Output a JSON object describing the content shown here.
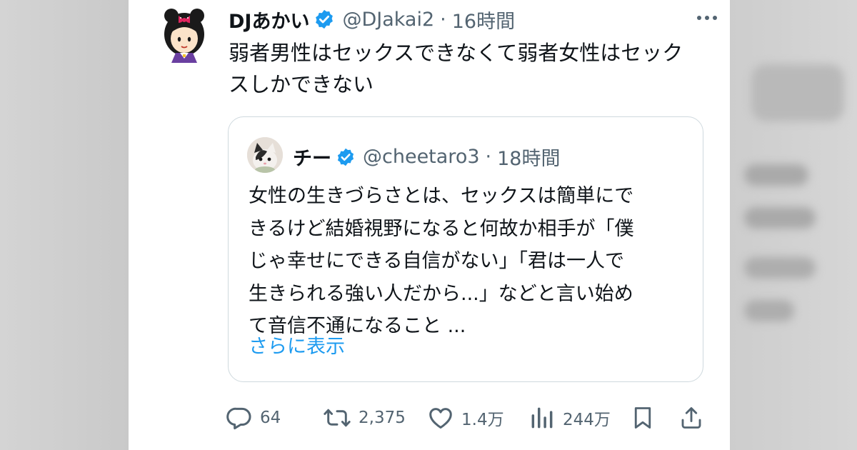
{
  "tweet": {
    "author_name": "DJあかい",
    "handle": "@DJakai2",
    "separator": "·",
    "time": "16時間",
    "text_line1": "弱者男性はセックスできなくて弱者女性はセック",
    "text_line2": "スしかできない"
  },
  "quote": {
    "author_name": "チー",
    "handle": "@cheetaro3",
    "separator": "·",
    "time": "18時間",
    "text_lines": [
      "女性の生きづらさとは、セックスは簡単にで",
      "きるけど結婚視野になると何故か相手が「僕",
      "じゃ幸せにできる自信がない」「君は一人で",
      "生きられる強い人だから...」などと言い始め",
      "て音信不通になること ..."
    ],
    "show_more": "さらに表示"
  },
  "actions": {
    "replies": "64",
    "retweets": "2,375",
    "likes": "1.4万",
    "views": "244万"
  },
  "icons": {
    "verified": "verified-badge-icon",
    "more": "more-dots-icon",
    "reply": "reply-bubble-icon",
    "retweet": "retweet-arrows-icon",
    "like": "heart-icon",
    "views": "bar-chart-icon",
    "bookmark": "bookmark-icon",
    "share": "share-upload-icon"
  },
  "colors": {
    "verified_blue": "#1d9bf0",
    "link_blue": "#1d9bf0",
    "secondary_text": "#536471",
    "quote_border": "#cfd9de"
  }
}
